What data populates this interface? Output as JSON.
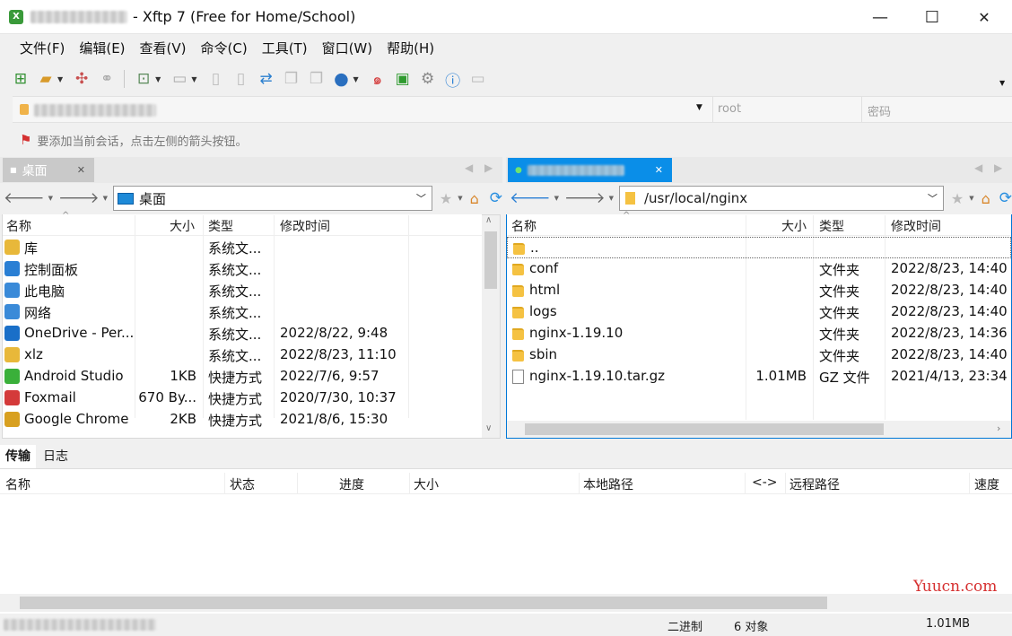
{
  "window": {
    "title": "- Xftp 7 (Free for Home/School)",
    "minimize": "—",
    "maximize": "☐",
    "close": "✕"
  },
  "menu": [
    "文件(F)",
    "编辑(E)",
    "查看(V)",
    "命令(C)",
    "工具(T)",
    "窗口(W)",
    "帮助(H)"
  ],
  "address_bar": {
    "user_placeholder": "root",
    "password_placeholder": "密码"
  },
  "hint": "要添加当前会话，点击左侧的箭头按钮。",
  "left": {
    "tab_label": "桌面",
    "path": "桌面",
    "columns": [
      "名称",
      "大小",
      "类型",
      "修改时间"
    ],
    "rows": [
      {
        "name": "库",
        "size": "",
        "type": "系统文...",
        "modified": "",
        "icon": "library-icon"
      },
      {
        "name": "控制面板",
        "size": "",
        "type": "系统文...",
        "modified": "",
        "icon": "control-panel-icon"
      },
      {
        "name": "此电脑",
        "size": "",
        "type": "系统文...",
        "modified": "",
        "icon": "computer-icon"
      },
      {
        "name": "网络",
        "size": "",
        "type": "系统文...",
        "modified": "",
        "icon": "network-icon"
      },
      {
        "name": "OneDrive - Per...",
        "size": "",
        "type": "系统文...",
        "modified": "2022/8/22, 9:48",
        "icon": "onedrive-icon"
      },
      {
        "name": "xlz",
        "size": "",
        "type": "系统文...",
        "modified": "2022/8/23, 11:10",
        "icon": "user-folder-icon"
      },
      {
        "name": "Android Studio",
        "size": "1KB",
        "type": "快捷方式",
        "modified": "2022/7/6, 9:57",
        "icon": "android-studio-icon"
      },
      {
        "name": "Foxmail",
        "size": "670 By...",
        "type": "快捷方式",
        "modified": "2020/7/30, 10:37",
        "icon": "foxmail-icon"
      },
      {
        "name": "Google Chrome",
        "size": "2KB",
        "type": "快捷方式",
        "modified": "2021/8/6, 15:30",
        "icon": "chrome-icon"
      }
    ]
  },
  "right": {
    "path": "/usr/local/nginx",
    "columns": [
      "名称",
      "大小",
      "类型",
      "修改时间"
    ],
    "rows": [
      {
        "name": "..",
        "size": "",
        "type": "",
        "modified": "",
        "kind": "folder"
      },
      {
        "name": "conf",
        "size": "",
        "type": "文件夹",
        "modified": "2022/8/23, 14:40",
        "kind": "folder"
      },
      {
        "name": "html",
        "size": "",
        "type": "文件夹",
        "modified": "2022/8/23, 14:40",
        "kind": "folder"
      },
      {
        "name": "logs",
        "size": "",
        "type": "文件夹",
        "modified": "2022/8/23, 14:40",
        "kind": "folder"
      },
      {
        "name": "nginx-1.19.10",
        "size": "",
        "type": "文件夹",
        "modified": "2022/8/23, 14:36",
        "kind": "folder"
      },
      {
        "name": "sbin",
        "size": "",
        "type": "文件夹",
        "modified": "2022/8/23, 14:40",
        "kind": "folder"
      },
      {
        "name": "nginx-1.19.10.tar.gz",
        "size": "1.01MB",
        "type": "GZ 文件",
        "modified": "2021/4/13, 23:34",
        "kind": "file"
      }
    ]
  },
  "bottom_tabs": [
    "传输",
    "日志"
  ],
  "transfer_columns": [
    "名称",
    "状态",
    "进度",
    "大小",
    "本地路径",
    "<->",
    "远程路径",
    "速度"
  ],
  "status": {
    "mode": "二进制",
    "count": "6 对象",
    "size": "1.01MB"
  },
  "watermark": "Yuucn.com",
  "colors": {
    "accent": "#0078d7",
    "selected_tab": "#0a8ee8",
    "panel_border": "#0078d7"
  }
}
